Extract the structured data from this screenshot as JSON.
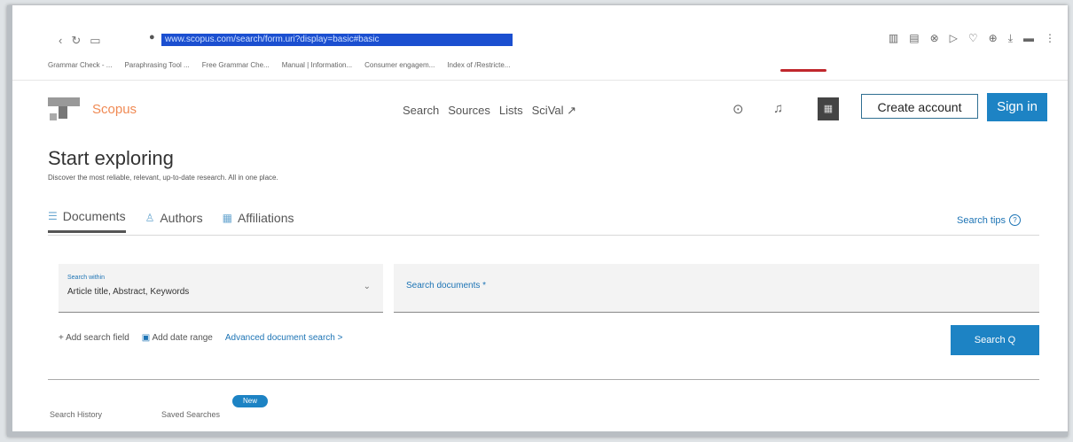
{
  "browser": {
    "url": "www.scopus.com/search/form.uri?display=basic#basic",
    "bookmarks": [
      "Grammar Check - ...",
      "Paraphrasing Tool ...",
      "Free Grammar Che...",
      "Manual | Information...",
      "Consumer engagem...",
      "Index of /Restricte..."
    ],
    "icons": [
      "extensions-icon",
      "reader-icon",
      "close-icon",
      "play-icon",
      "heart-icon",
      "cube-icon",
      "download-icon",
      "battery-icon",
      "menu-icon"
    ]
  },
  "header": {
    "brand": "Scopus",
    "nav": [
      "Search",
      "Sources",
      "Lists",
      "SciVal ↗"
    ],
    "create_account": "Create account",
    "sign_in": "Sign in"
  },
  "main": {
    "title": "Start exploring",
    "subtitle": "Discover the most reliable, relevant, up-to-date research. All in one place.",
    "tabs": [
      {
        "label": "Documents",
        "icon": "☰"
      },
      {
        "label": "Authors",
        "icon": "♙"
      },
      {
        "label": "Affiliations",
        "icon": "▦"
      }
    ],
    "search_tips": "Search tips",
    "search_within_label": "Search within",
    "search_within_value": "Article title, Abstract, Keywords",
    "search_placeholder": "Search documents *",
    "add_field": "Add search field",
    "add_date": "Add date range",
    "advanced": "Advanced document search >",
    "search_button": "Search Q",
    "history": "Search History",
    "saved": "Saved Searches",
    "new_badge": "New"
  },
  "colors": {
    "accent": "#1d83c4",
    "brand": "#f08a54"
  }
}
